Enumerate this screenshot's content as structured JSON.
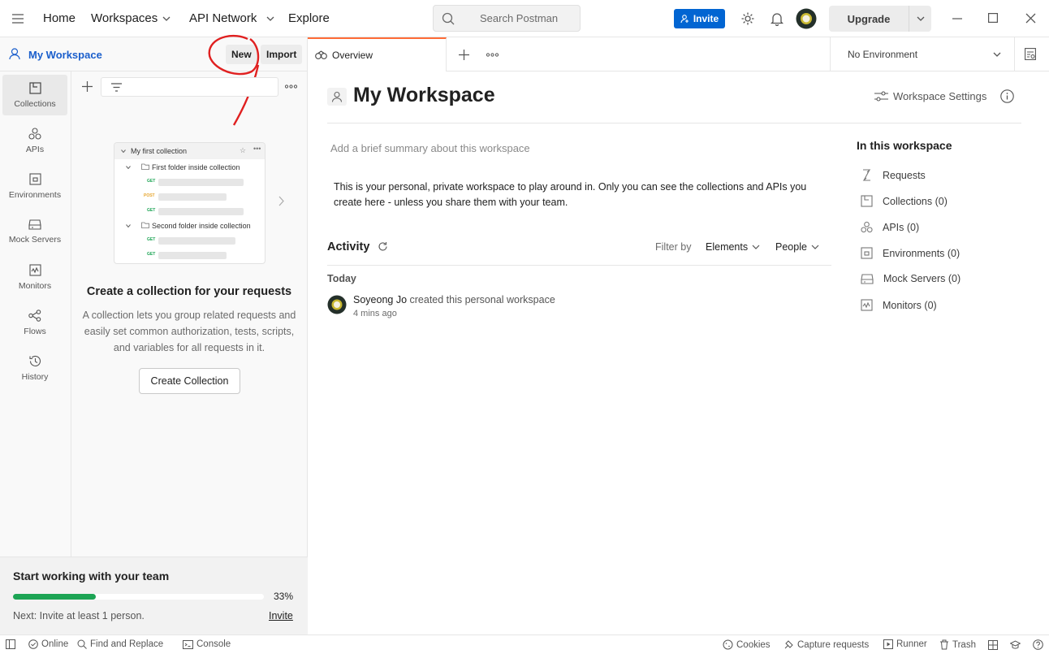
{
  "topbar": {
    "nav": [
      "Home",
      "Workspaces",
      "API Network",
      "Explore"
    ],
    "search_placeholder": "Search Postman",
    "invite": "Invite",
    "upgrade": "Upgrade"
  },
  "sidebar_header": {
    "workspace_name": "My Workspace",
    "new": "New",
    "import": "Import"
  },
  "sidenav": [
    "Collections",
    "APIs",
    "Environments",
    "Mock Servers",
    "Monitors",
    "Flows",
    "History"
  ],
  "illustration": {
    "collection": "My first collection",
    "folder1": "First folder inside collection",
    "folder2": "Second folder inside collection",
    "methods": [
      "GET",
      "POST",
      "GET",
      "GET",
      "GET"
    ]
  },
  "empty_state": {
    "title": "Create a collection for your requests",
    "description": "A collection lets you group related requests and easily set common authorization, tests, scripts, and variables for all requests in it.",
    "button": "Create Collection"
  },
  "team": {
    "title": "Start working with your team",
    "progress": 0.33,
    "progress_label": "33%",
    "next": "Next: Invite at least 1 person.",
    "invite_link": "Invite"
  },
  "tabs": {
    "overview": "Overview"
  },
  "environment": "No Environment",
  "workspace": {
    "title": "My Workspace",
    "settings": "Workspace Settings",
    "summary_placeholder": "Add a brief summary about this workspace",
    "description": "This is your personal, private workspace to play around in. Only you can see the collections and APIs you create here - unless you share them with your team."
  },
  "activity": {
    "title": "Activity",
    "filter_by": "Filter by",
    "elements": "Elements",
    "people": "People",
    "today": "Today",
    "user": "Soyeong Jo",
    "action": " created this personal workspace",
    "time": "4 mins ago"
  },
  "in_workspace": {
    "title": "In this workspace",
    "items": [
      "Requests",
      "Collections (0)",
      "APIs (0)",
      "Environments (0)",
      "Mock Servers (0)",
      "Monitors (0)"
    ]
  },
  "statusbar": {
    "online": "Online",
    "find_replace": "Find and Replace",
    "console": "Console",
    "cookies": "Cookies",
    "capture": "Capture requests",
    "runner": "Runner",
    "trash": "Trash"
  },
  "colors": {
    "accent": "#ff6c37",
    "invite_blue": "#0265d2",
    "progress_green": "#1ca454",
    "annotation_red": "#e02020"
  }
}
